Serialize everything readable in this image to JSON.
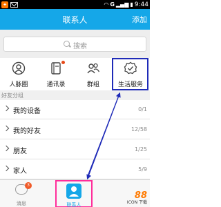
{
  "statusbar": {
    "network": "G",
    "time": "9:44"
  },
  "titlebar": {
    "title": "联系人",
    "add_label": "添加"
  },
  "search": {
    "placeholder": "搜索"
  },
  "quick_actions": [
    {
      "label": "人脉圈",
      "icon": "people-circle-icon"
    },
    {
      "label": "通讯录",
      "icon": "address-book-icon"
    },
    {
      "label": "群组",
      "icon": "group-icon"
    },
    {
      "label": "生活服务",
      "icon": "service-shield-icon"
    }
  ],
  "group_section": {
    "header": "好友分组"
  },
  "groups": [
    {
      "name": "我的设备",
      "count": "0/1"
    },
    {
      "name": "我的好友",
      "count": "12/58"
    },
    {
      "name": "朋友",
      "count": "1/25"
    },
    {
      "name": "家人",
      "count": "5/9"
    }
  ],
  "tabbar": {
    "messages": {
      "label": "消息",
      "badge": "3"
    },
    "contacts": {
      "label": "联系人"
    }
  },
  "watermark": {
    "number": "88",
    "sub": "ICON 下载"
  },
  "colors": {
    "accent": "#15a7e8",
    "highlight_box": "#1f2bb8",
    "tab_highlight": "#ff2d9a",
    "badge": "#f05a28"
  }
}
